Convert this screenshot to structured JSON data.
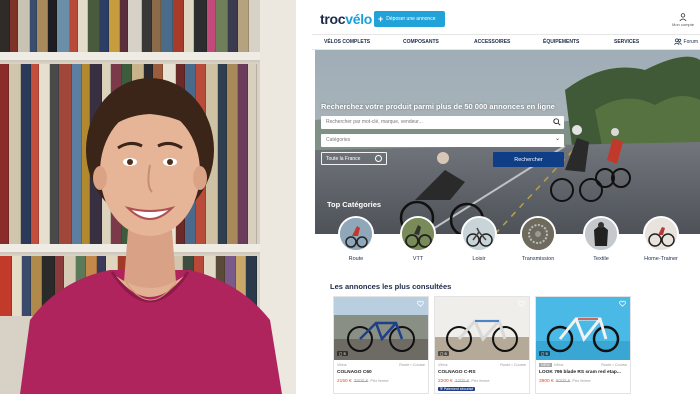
{
  "site": {
    "logo_main": "troc",
    "logo_accent": "vélo",
    "post_ad_button": "Déposer une annonce",
    "account_label": "Mon compte",
    "forum_label": "Forum",
    "nav": [
      "VÉLOS COMPLETS",
      "COMPOSANTS",
      "ACCESSOIRES",
      "ÉQUIPEMENTS",
      "SERVICES"
    ],
    "hero": {
      "title": "Recherchez votre produit parmi plus de 50 000 annonces en ligne",
      "search_placeholder": "Rechercher par mot-clé, marque, vendeur...",
      "category_placeholder": "Catégories",
      "location_value": "Toute la France",
      "search_button": "Rechercher"
    },
    "top_categories_title": "Top Catégories",
    "categories": [
      "Route",
      "VTT",
      "Loisir",
      "Transmission",
      "Textile",
      "Home-Trainer"
    ],
    "most_viewed_title": "Les annonces les plus consultées",
    "listings": [
      {
        "photo_count": "5",
        "type": "Vélos",
        "subtype": "Route • Course",
        "name": "COLNAGO C60",
        "price": "2150 €",
        "old_price": "3500 €",
        "price_note": "Prix ferme",
        "secure_badge": "",
        "new_tag": ""
      },
      {
        "photo_count": "6",
        "type": "Vélos",
        "subtype": "Route • Course",
        "name": "COLNAGO C-RS",
        "price": "2200 €",
        "old_price": "3200 €",
        "price_note": "Prix ferme",
        "secure_badge": "Paiement sécurisé",
        "new_tag": ""
      },
      {
        "photo_count": "5",
        "type": "Vélos",
        "subtype": "Route • Course",
        "name": "LOOK 795 blade RS sram red etap...",
        "price": "3900 €",
        "old_price": "8000 €",
        "price_note": "Prix ferme",
        "secure_badge": "",
        "new_tag": "NEW"
      }
    ],
    "colors": {
      "brand_navy": "#1c2b4a",
      "brand_blue": "#21a3d9",
      "search_button": "#0f3e86",
      "price_red": "#e74c1c"
    }
  }
}
